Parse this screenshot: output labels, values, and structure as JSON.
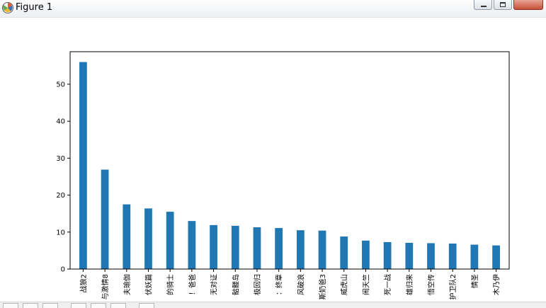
{
  "window": {
    "title": "Figure 1"
  },
  "toolbar": {
    "buttons": [
      "home-icon",
      "back-icon",
      "forward-icon",
      "pan-icon",
      "zoom-icon",
      "configure-icon",
      "save-icon"
    ]
  },
  "chart_data": {
    "type": "bar",
    "title": "",
    "xlabel": "",
    "ylabel": "",
    "ylim": [
      0,
      58.8
    ],
    "yticks": [
      0,
      10,
      20,
      30,
      40,
      50
    ],
    "bar_color": "#1f77b4",
    "grid": false,
    "categories": [
      "战狼2",
      "与激情8",
      "夫瑜伽",
      "伏妖篇",
      "的骑士",
      "！爸爸",
      "无对证",
      "骷髅岛",
      "极回归",
      "：终章",
      "风破浪",
      "斯奶爸3",
      "威虎山",
      "闹天竺",
      "死一战",
      "雄归来",
      "悟空传",
      "护卫队2",
      "情圣",
      "木乃伊"
    ],
    "values": [
      56.0,
      26.9,
      17.5,
      16.4,
      15.5,
      13.0,
      11.9,
      11.7,
      11.3,
      11.1,
      10.5,
      10.4,
      8.8,
      7.7,
      7.3,
      7.1,
      7.0,
      6.9,
      6.6,
      6.4
    ]
  }
}
